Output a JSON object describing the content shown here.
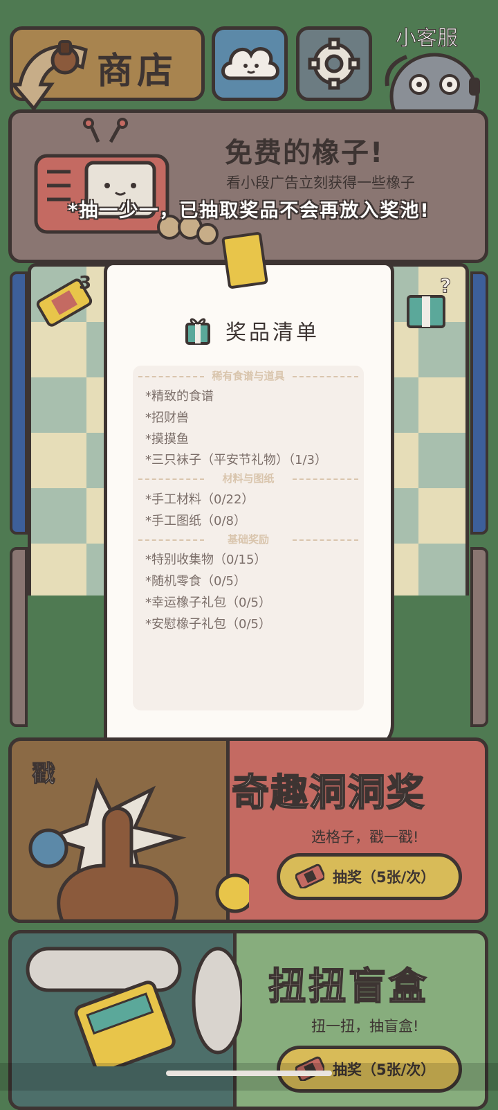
{
  "header": {
    "shop_title": "商店",
    "customer_service_label": "小客服"
  },
  "free_acorn": {
    "title": "免费的橡子!",
    "subtitle": "看小段广告立刻获得一些橡子"
  },
  "notice": "*抽一少一，已抽取奖品不会再放入奖池!",
  "board": {
    "ticket_count": "3",
    "mystery_mark": "?"
  },
  "prize_list": {
    "title": "奖品清单",
    "sections": [
      {
        "header": "稀有食谱与道具",
        "items": [
          "*精致的食谱",
          "*招财兽",
          "*摸摸鱼",
          "*三只袜子（平安节礼物）（1/3）"
        ]
      },
      {
        "header": "材料与图纸",
        "items": [
          "*手工材料（0/22）",
          "*手工图纸（0/8）"
        ]
      },
      {
        "header": "基础奖励",
        "items": [
          "*特别收集物（0/15）",
          "*随机零食（0/5）",
          "*幸运橡子礼包（0/5）",
          "*安慰橡子礼包（0/5）"
        ]
      }
    ]
  },
  "hole_panel": {
    "poke_text": "戳",
    "title": "奇趣洞洞奖",
    "subtitle": "选格子，戳一戳!",
    "button_label": "抽奖（5张/次）"
  },
  "twist_panel": {
    "title": "扭扭盲盒",
    "subtitle": "扭一扭，抽盲盒!",
    "button_label": "抽奖（5张/次）"
  },
  "colors": {
    "background": "#4f7a52",
    "outline": "#3d3432",
    "shop": "#a8844f",
    "button_yellow": "#d8bb58",
    "hole_red": "#c46a62",
    "paper": "#fdfaf6"
  }
}
